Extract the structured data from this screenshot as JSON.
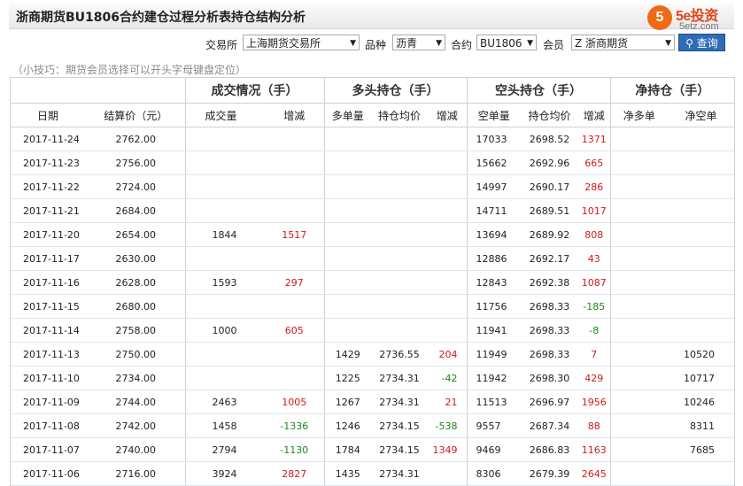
{
  "page": {
    "title": "浙商期货BU1806合约建仓过程分析表持仓结构分析",
    "logo_mark": "5",
    "logo_brand": "5e投资",
    "logo_site": "5etz.com",
    "tip": "（小技巧：期货会员选择可以开头字母键盘定位）"
  },
  "filters": {
    "exchange_label": "交易所",
    "exchange_value": "上海期货交易所",
    "variety_label": "品种",
    "variety_value": "沥青",
    "contract_label": "合约",
    "contract_value": "BU1806",
    "member_label": "会员",
    "member_value": "Z 浙商期货",
    "query_label": "查询",
    "arrow": "▼"
  },
  "table": {
    "group_headers": {
      "trade": "成交情况（手）",
      "long": "多头持仓（手）",
      "short": "空头持仓（手）",
      "net": "净持仓（手）"
    },
    "column_headers": {
      "date": "日期",
      "settle": "结算价（元）",
      "volume": "成交量",
      "vol_change": "增减",
      "long_pos": "多单量",
      "long_avg": "持仓均价",
      "long_change": "增减",
      "short_pos": "空单量",
      "short_avg": "持仓均价",
      "short_change": "增减",
      "net_long": "净多单",
      "net_short": "净空单"
    },
    "rows": [
      {
        "date": "2017-11-24",
        "settle": "2762.00",
        "volume": "",
        "vol_change": "",
        "vol_color": "",
        "long_pos": "",
        "long_avg": "",
        "long_change": "",
        "long_color": "",
        "short_pos": "17033",
        "short_avg": "2698.52",
        "short_change": "1371",
        "short_color": "red",
        "net_long": "",
        "net_short": ""
      },
      {
        "date": "2017-11-23",
        "settle": "2756.00",
        "volume": "",
        "vol_change": "",
        "vol_color": "",
        "long_pos": "",
        "long_avg": "",
        "long_change": "",
        "long_color": "",
        "short_pos": "15662",
        "short_avg": "2692.96",
        "short_change": "665",
        "short_color": "red",
        "net_long": "",
        "net_short": ""
      },
      {
        "date": "2017-11-22",
        "settle": "2724.00",
        "volume": "",
        "vol_change": "",
        "vol_color": "",
        "long_pos": "",
        "long_avg": "",
        "long_change": "",
        "long_color": "",
        "short_pos": "14997",
        "short_avg": "2690.17",
        "short_change": "286",
        "short_color": "red",
        "net_long": "",
        "net_short": ""
      },
      {
        "date": "2017-11-21",
        "settle": "2684.00",
        "volume": "",
        "vol_change": "",
        "vol_color": "",
        "long_pos": "",
        "long_avg": "",
        "long_change": "",
        "long_color": "",
        "short_pos": "14711",
        "short_avg": "2689.51",
        "short_change": "1017",
        "short_color": "red",
        "net_long": "",
        "net_short": ""
      },
      {
        "date": "2017-11-20",
        "settle": "2654.00",
        "volume": "1844",
        "vol_change": "1517",
        "vol_color": "red",
        "long_pos": "",
        "long_avg": "",
        "long_change": "",
        "long_color": "",
        "short_pos": "13694",
        "short_avg": "2689.92",
        "short_change": "808",
        "short_color": "red",
        "net_long": "",
        "net_short": ""
      },
      {
        "date": "2017-11-17",
        "settle": "2630.00",
        "volume": "",
        "vol_change": "",
        "vol_color": "",
        "long_pos": "",
        "long_avg": "",
        "long_change": "",
        "long_color": "",
        "short_pos": "12886",
        "short_avg": "2692.17",
        "short_change": "43",
        "short_color": "red",
        "net_long": "",
        "net_short": ""
      },
      {
        "date": "2017-11-16",
        "settle": "2628.00",
        "volume": "1593",
        "vol_change": "297",
        "vol_color": "red",
        "long_pos": "",
        "long_avg": "",
        "long_change": "",
        "long_color": "",
        "short_pos": "12843",
        "short_avg": "2692.38",
        "short_change": "1087",
        "short_color": "red",
        "net_long": "",
        "net_short": ""
      },
      {
        "date": "2017-11-15",
        "settle": "2680.00",
        "volume": "",
        "vol_change": "",
        "vol_color": "",
        "long_pos": "",
        "long_avg": "",
        "long_change": "",
        "long_color": "",
        "short_pos": "11756",
        "short_avg": "2698.33",
        "short_change": "-185",
        "short_color": "green",
        "net_long": "",
        "net_short": ""
      },
      {
        "date": "2017-11-14",
        "settle": "2758.00",
        "volume": "1000",
        "vol_change": "605",
        "vol_color": "red",
        "long_pos": "",
        "long_avg": "",
        "long_change": "",
        "long_color": "",
        "short_pos": "11941",
        "short_avg": "2698.33",
        "short_change": "-8",
        "short_color": "green",
        "net_long": "",
        "net_short": ""
      },
      {
        "date": "2017-11-13",
        "settle": "2750.00",
        "volume": "",
        "vol_change": "",
        "vol_color": "",
        "long_pos": "1429",
        "long_avg": "2736.55",
        "long_change": "204",
        "long_color": "red",
        "short_pos": "11949",
        "short_avg": "2698.33",
        "short_change": "7",
        "short_color": "red",
        "net_long": "",
        "net_short": "10520"
      },
      {
        "date": "2017-11-10",
        "settle": "2734.00",
        "volume": "",
        "vol_change": "",
        "vol_color": "",
        "long_pos": "1225",
        "long_avg": "2734.31",
        "long_change": "-42",
        "long_color": "green",
        "short_pos": "11942",
        "short_avg": "2698.30",
        "short_change": "429",
        "short_color": "red",
        "net_long": "",
        "net_short": "10717"
      },
      {
        "date": "2017-11-09",
        "settle": "2744.00",
        "volume": "2463",
        "vol_change": "1005",
        "vol_color": "red",
        "long_pos": "1267",
        "long_avg": "2734.31",
        "long_change": "21",
        "long_color": "red",
        "short_pos": "11513",
        "short_avg": "2696.97",
        "short_change": "1956",
        "short_color": "red",
        "net_long": "",
        "net_short": "10246"
      },
      {
        "date": "2017-11-08",
        "settle": "2742.00",
        "volume": "1458",
        "vol_change": "-1336",
        "vol_color": "green",
        "long_pos": "1246",
        "long_avg": "2734.15",
        "long_change": "-538",
        "long_color": "green",
        "short_pos": "9557",
        "short_avg": "2687.34",
        "short_change": "88",
        "short_color": "red",
        "net_long": "",
        "net_short": "8311"
      },
      {
        "date": "2017-11-07",
        "settle": "2740.00",
        "volume": "2794",
        "vol_change": "-1130",
        "vol_color": "green",
        "long_pos": "1784",
        "long_avg": "2734.15",
        "long_change": "1349",
        "long_color": "red",
        "short_pos": "9469",
        "short_avg": "2686.83",
        "short_change": "1163",
        "short_color": "red",
        "net_long": "",
        "net_short": "7685"
      },
      {
        "date": "2017-11-06",
        "settle": "2716.00",
        "volume": "3924",
        "vol_change": "2827",
        "vol_color": "red",
        "long_pos": "1435",
        "long_avg": "2734.31",
        "long_change": "",
        "long_color": "",
        "short_pos": "8306",
        "short_avg": "2679.39",
        "short_change": "2645",
        "short_color": "red",
        "net_long": "",
        "net_short": ""
      }
    ]
  },
  "colors": {
    "red": "#d21a1a",
    "green": "#1b8a1b",
    "accent": "#2e6db5",
    "logo": "#ef6a16"
  }
}
